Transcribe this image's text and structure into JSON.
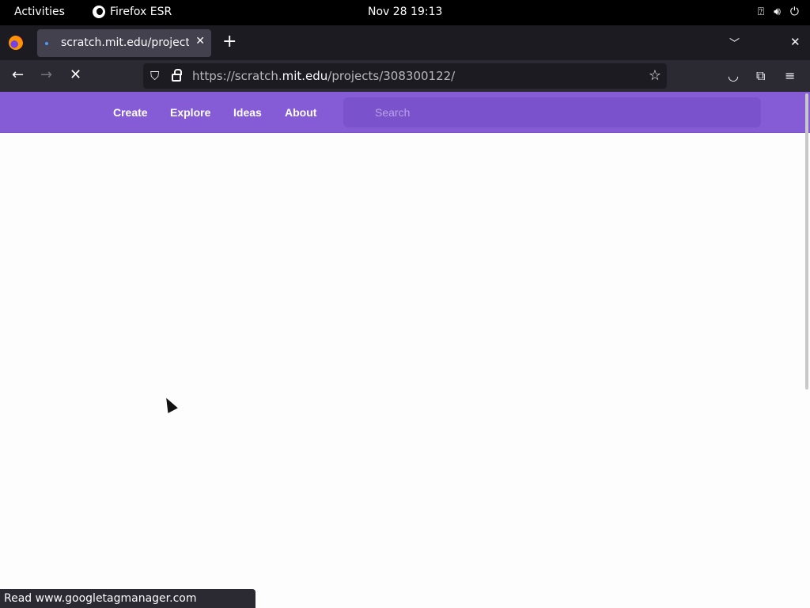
{
  "system": {
    "activities": "Activities",
    "app_name": "Firefox ESR",
    "clock": "Nov 28  19:13",
    "icons": [
      "accessibility-icon",
      "volume-icon",
      "power-icon"
    ]
  },
  "browser": {
    "tab_title": "scratch.mit.edu/projects/",
    "new_tab": "+",
    "url_prefix": "https://scratch.",
    "url_domain": "mit.edu",
    "url_path": "/projects/308300122/",
    "status_text": "Read www.googletagmanager.com"
  },
  "scratch": {
    "nav": [
      "Create",
      "Explore",
      "Ideas",
      "About"
    ],
    "search_placeholder": "Search",
    "header_color": "#855cd6"
  }
}
